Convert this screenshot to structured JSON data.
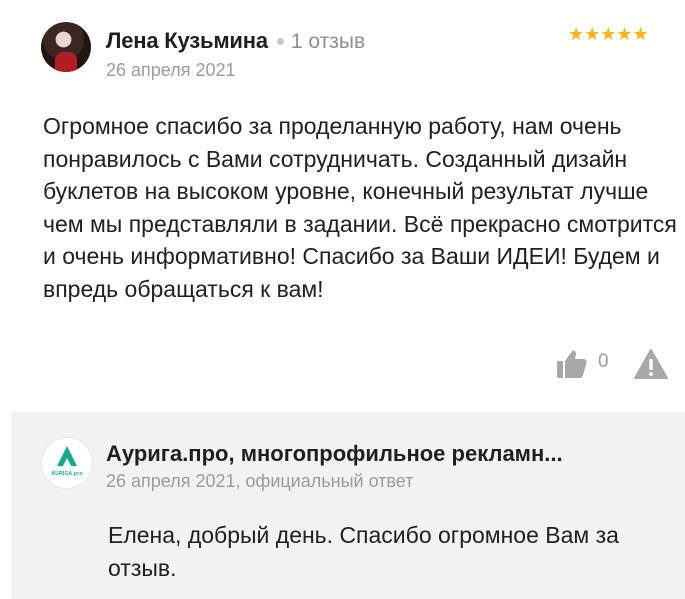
{
  "review": {
    "author_name": "Лена Кузьмина",
    "review_count": "1 отзыв",
    "date": "26 апреля 2021",
    "rating": 5,
    "stars": "★★★★★",
    "rating_color": "#f4b41a",
    "text": "Огромное спасибо за проделанную работу, нам очень понравилось с Вами сотрудничать. Созданный дизайн буклетов на высоком уровне, конечный результат лучше чем мы представляли в задании. Всё прекрасно смотрится и очень информативно! Спасибо за Ваши ИДЕИ! Будем и впредь обращаться к вам!",
    "like_count": "0",
    "icons": {
      "like": "thumbs-up-icon",
      "report": "warning-icon"
    }
  },
  "reply": {
    "company_name": "Аурига.про, многопрофильное рекламн...",
    "meta": "26 апреля 2021, официальный ответ",
    "logo_text": "AURIGA.pro",
    "text": "Елена, добрый день. Спасибо огромное Вам за отзыв.",
    "brand_color": "#1aa88a"
  }
}
